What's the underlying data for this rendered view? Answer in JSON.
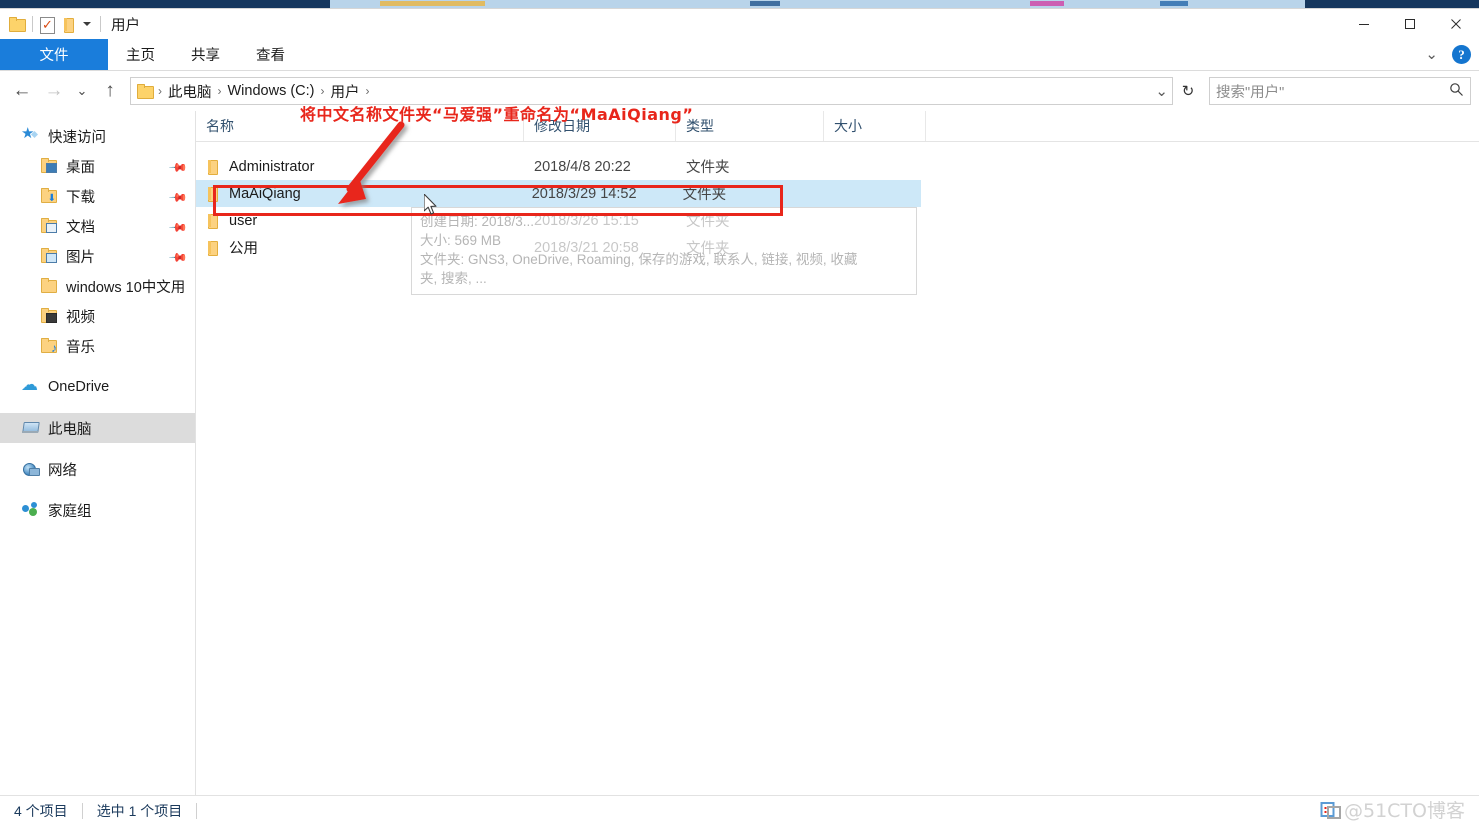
{
  "window": {
    "title": "用户",
    "controls": {
      "minimize": "—",
      "maximize": "□",
      "close": "✕",
      "expand_ribbon": "⌄",
      "help": "?"
    }
  },
  "quick_access_toolbar": {
    "items": [
      {
        "name": "folder-icon",
        "label": ""
      },
      {
        "name": "properties-icon",
        "label": ""
      },
      {
        "name": "new-folder-icon",
        "label": ""
      },
      {
        "name": "customize-dropdown",
        "label": ""
      }
    ]
  },
  "ribbon": {
    "tabs": [
      {
        "label": "文件",
        "active": true
      },
      {
        "label": "主页",
        "active": false
      },
      {
        "label": "共享",
        "active": false
      },
      {
        "label": "查看",
        "active": false
      }
    ]
  },
  "navigation": {
    "back": "←",
    "forward": "→",
    "recent": "⌄",
    "up": "↑",
    "refresh": "↻",
    "breadcrumbs": [
      "此电脑",
      "Windows (C:)",
      "用户"
    ],
    "separator": "›"
  },
  "search": {
    "placeholder": "搜索\"用户\"",
    "value": "",
    "icon": "search-icon"
  },
  "sidebar": {
    "groups": [
      {
        "name": "快速访问",
        "icon": "star-pin-icon",
        "items": [
          {
            "label": "桌面",
            "icon": "desktop-folder-icon",
            "pinned": true
          },
          {
            "label": "下载",
            "icon": "downloads-folder-icon",
            "pinned": true
          },
          {
            "label": "文档",
            "icon": "documents-folder-icon",
            "pinned": true
          },
          {
            "label": "图片",
            "icon": "pictures-folder-icon",
            "pinned": true
          },
          {
            "label": "windows 10中文用",
            "icon": "folder-icon",
            "pinned": false
          },
          {
            "label": "视频",
            "icon": "videos-folder-icon",
            "pinned": false
          },
          {
            "label": "音乐",
            "icon": "music-folder-icon",
            "pinned": false
          }
        ]
      },
      {
        "name": "OneDrive",
        "icon": "cloud-icon",
        "items": []
      },
      {
        "name": "此电脑",
        "icon": "this-pc-icon",
        "items": [],
        "selected": true
      },
      {
        "name": "网络",
        "icon": "network-icon",
        "items": []
      },
      {
        "name": "家庭组",
        "icon": "homegroup-icon",
        "items": []
      }
    ]
  },
  "file_list": {
    "columns": [
      {
        "key": "name",
        "label": "名称"
      },
      {
        "key": "date",
        "label": "修改日期"
      },
      {
        "key": "type",
        "label": "类型"
      },
      {
        "key": "size",
        "label": "大小"
      }
    ],
    "rows": [
      {
        "name": "Administrator",
        "date": "2018/4/8 20:22",
        "type": "文件夹",
        "size": "",
        "selected": false
      },
      {
        "name": "MaAiQiang",
        "date": "2018/3/29 14:52",
        "type": "文件夹",
        "size": "",
        "selected": true
      },
      {
        "name": "user",
        "date": "2018/3/26 15:15",
        "type": "文件夹",
        "size": "",
        "selected": false
      },
      {
        "name": "公用",
        "date": "2018/3/21 20:58",
        "type": "文件夹",
        "size": "",
        "selected": false
      }
    ]
  },
  "tooltip": {
    "line1": "创建日期: 2018/3...",
    "line2": "大小: 569 MB",
    "line3": "文件夹: GNS3, OneDrive, Roaming, 保存的游戏, 联系人, 链接, 视频, 收藏",
    "line4": "夹, 搜索, ..."
  },
  "annotation": {
    "text_cn": "将中文名称文件夹“马爱强”重命名为",
    "text_latin": "“MaAiQiang”",
    "color": "#e8261b",
    "shape": "arrow-and-rectangle"
  },
  "status_bar": {
    "item_count": "4 个项目",
    "selection_count": "选中 1 个项目"
  },
  "watermark": {
    "text": "@51CTO博客"
  },
  "colors": {
    "accent_blue": "#1a7ddb",
    "selection_blue": "#cde8f8",
    "annotation_red": "#e8261b",
    "titlebar_strip": "#16375e",
    "sidebar_selected": "#dcdcdc"
  }
}
